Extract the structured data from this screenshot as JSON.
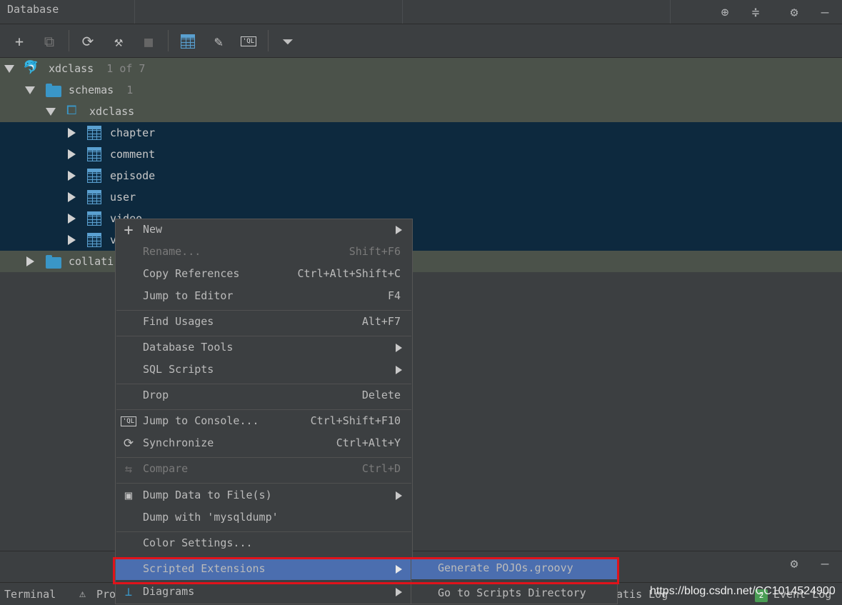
{
  "header": {
    "title": "Database"
  },
  "tree": {
    "root": {
      "label": "xdclass",
      "count": "1 of 7"
    },
    "schemas": {
      "label": "schemas",
      "count": "1"
    },
    "schema": {
      "label": "xdclass"
    },
    "tables": [
      "chapter",
      "comment",
      "episode",
      "user",
      "video",
      "v"
    ],
    "collations": {
      "label": "collati"
    }
  },
  "context_menu": {
    "new": "New",
    "rename": {
      "label": "Rename...",
      "shortcut": "Shift+F6"
    },
    "copy_references": {
      "label": "Copy References",
      "shortcut": "Ctrl+Alt+Shift+C"
    },
    "jump_to_editor": {
      "label": "Jump to Editor",
      "shortcut": "F4"
    },
    "find_usages": {
      "label": "Find Usages",
      "shortcut": "Alt+F7"
    },
    "database_tools": "Database Tools",
    "sql_scripts": "SQL Scripts",
    "drop": {
      "label": "Drop",
      "shortcut": "Delete"
    },
    "jump_to_console": {
      "label": "Jump to Console...",
      "shortcut": "Ctrl+Shift+F10"
    },
    "synchronize": {
      "label": "Synchronize",
      "shortcut": "Ctrl+Alt+Y"
    },
    "compare": {
      "label": "Compare",
      "shortcut": "Ctrl+D"
    },
    "dump_data": "Dump Data to File(s)",
    "dump_mysqldump": "Dump with 'mysqldump'",
    "color_settings": "Color Settings...",
    "scripted_extensions": "Scripted Extensions",
    "diagrams": "Diagrams"
  },
  "submenu": {
    "generate_pojos": "Generate POJOs.groovy",
    "go_to_scripts": "Go to Scripts Directory"
  },
  "statusbar": {
    "terminal": "Terminal",
    "problems": "Pro",
    "batis_log": "atis Log",
    "watermark": "https://blog.csdn.net/CC1014524900",
    "event_log": "Event Log",
    "event_count": "2"
  },
  "colors": {
    "selection": "#0d293e",
    "highlight_row": "#4b524a",
    "menu_active": "#4b6eaf",
    "annotation_box": "#e0131b"
  }
}
